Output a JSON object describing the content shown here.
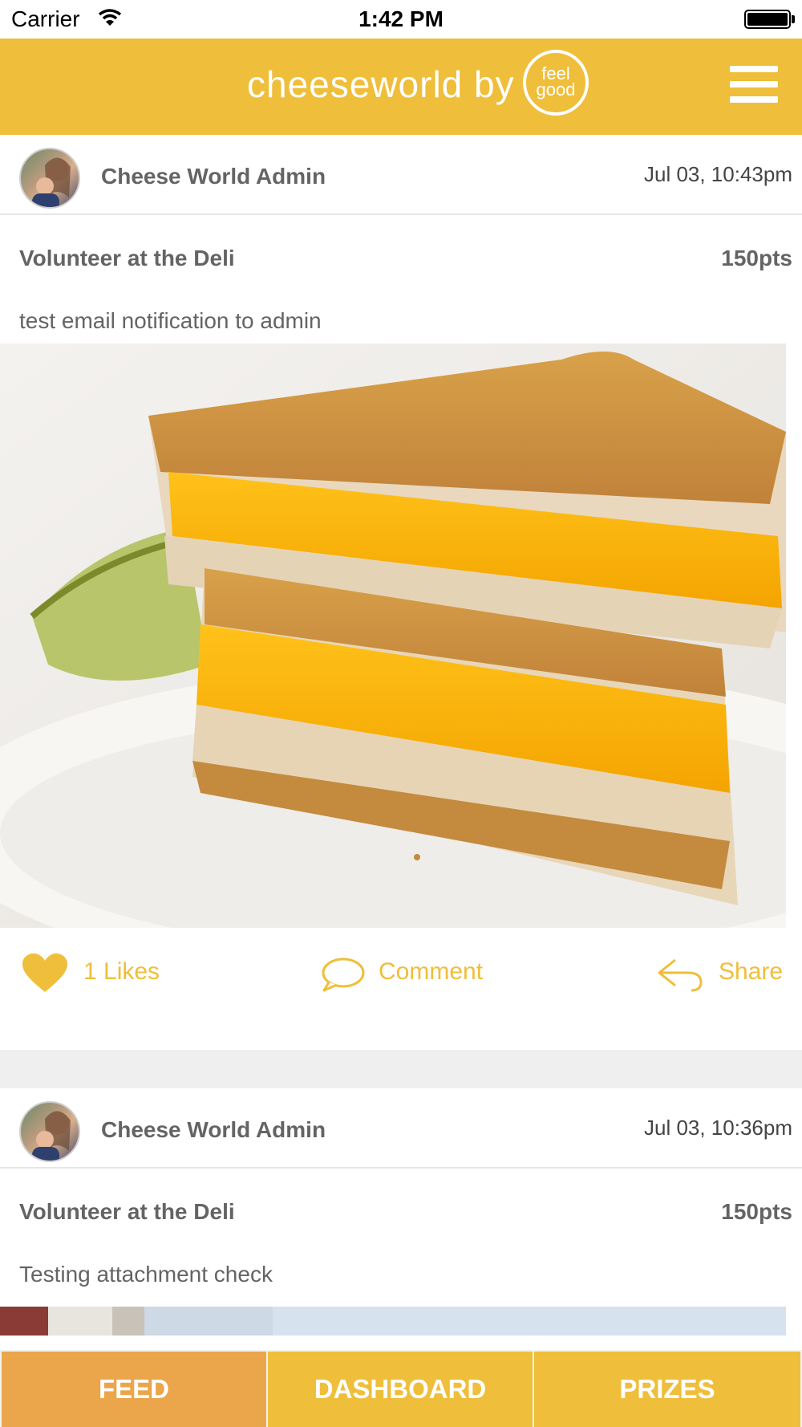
{
  "status_bar": {
    "carrier": "Carrier",
    "time": "1:42 PM"
  },
  "header": {
    "brand": "cheeseworld by",
    "badge_line1": "feel",
    "badge_line2": "good",
    "menu_icon": "hamburger-menu-icon"
  },
  "colors": {
    "accent": "#efbe3a",
    "tab_active": "#eba54a",
    "text_gray": "#646464"
  },
  "posts": [
    {
      "author": "Cheese World Admin",
      "timestamp": "Jul 03, 10:43pm",
      "title": "Volunteer at the Deli",
      "points": "150pts",
      "body": "test email notification to admin",
      "image": "grilled-cheese-sandwich-photo",
      "likes_label": "1 Likes",
      "comment_label": "Comment",
      "share_label": "Share"
    },
    {
      "author": "Cheese World Admin",
      "timestamp": "Jul 03, 10:36pm",
      "title": "Volunteer at the Deli",
      "points": "150pts",
      "body": "Testing attachment check",
      "image": "building-photo"
    }
  ],
  "tabs": [
    {
      "label": "FEED",
      "active": true
    },
    {
      "label": "DASHBOARD",
      "active": false
    },
    {
      "label": "PRIZES",
      "active": false
    }
  ]
}
